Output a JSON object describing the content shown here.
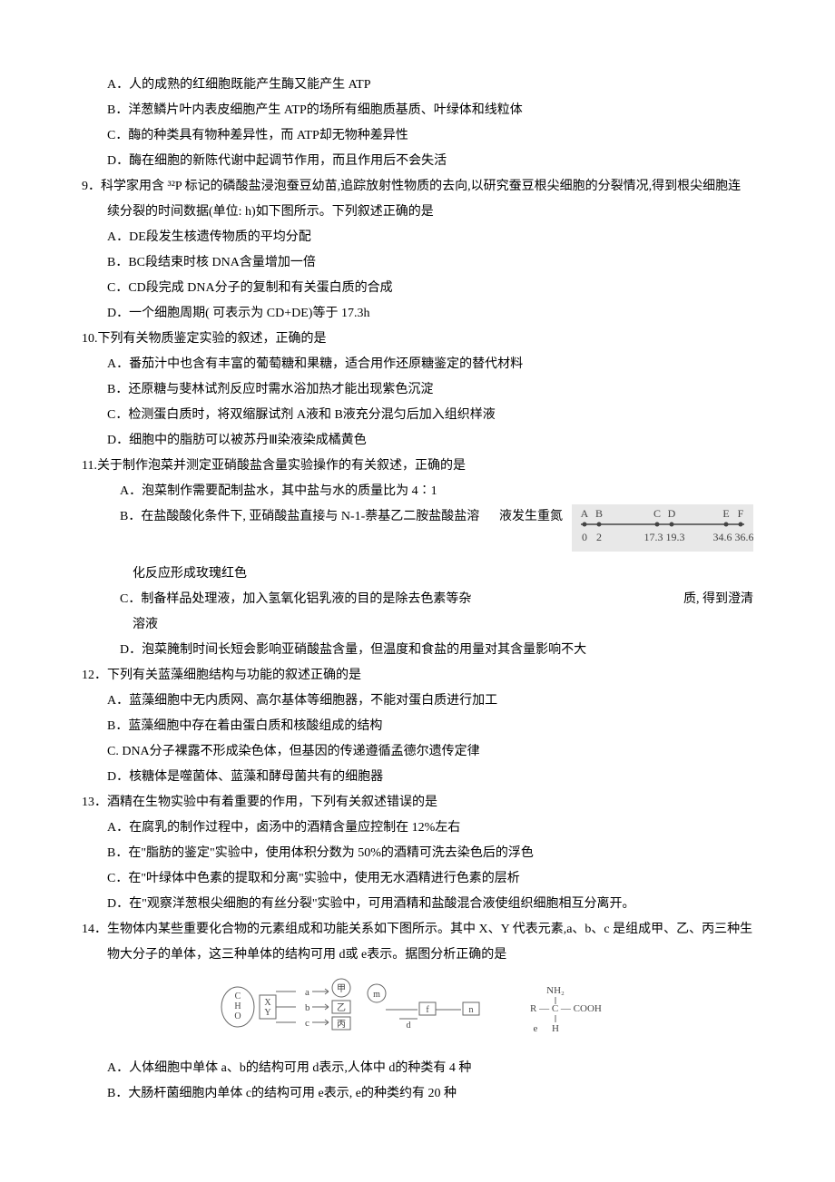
{
  "q8": {
    "A": "A．人的成熟的红细胞既能产生酶又能产生 ATP",
    "B": "B．洋葱鳞片叶内表皮细胞产生 ATP的场所有细胞质基质、叶绿体和线粒体",
    "C": "C．酶的种类具有物种差异性，而 ATP却无物种差异性",
    "D": "D．酶在细胞的新陈代谢中起调节作用，而且作用后不会失活"
  },
  "q9": {
    "stem1": "9．科学家用含 ³²P 标记的磷酸盐浸泡蚕豆幼苗,追踪放射性物质的去向,以研究蚕豆根尖细胞的分裂情况,得到根尖细胞连",
    "stem2": "续分裂的时间数据(单位: h)如下图所示。下列叙述正确的是",
    "A": "A．DE段发生核遗传物质的平均分配",
    "B": "B．BC段结束时核 DNA含量增加一倍",
    "C": "C．CD段完成 DNA分子的复制和有关蛋白质的合成",
    "D": "D．一个细胞周期( 可表示为 CD+DE)等于 17.3h"
  },
  "q10": {
    "stem": "10.下列有关物质鉴定实验的叙述，正确的是",
    "A": "A．番茄汁中也含有丰富的葡萄糖和果糖，适合用作还原糖鉴定的替代材料",
    "B": "B．还原糖与斐林试剂反应时需水浴加热才能出现紫色沉淀",
    "C": "C．检测蛋白质时，将双缩脲试剂 A液和 B液充分混匀后加入组织样液",
    "D": "D．细胞中的脂肪可以被苏丹Ⅲ染液染成橘黄色"
  },
  "q11": {
    "stem": "11.关于制作泡菜并测定亚硝酸盐含量实验操作的有关叙述，正确的是",
    "A": "A．泡菜制作需要配制盐水，其中盐与水的质量比为 4∶1",
    "B1": "B．在盐酸酸化条件下, 亚硝酸盐直接与 N-1-萘基乙二胺盐酸盐溶",
    "B2": "液发生重氮",
    "B3": "化反应形成玫瑰红色",
    "C1": "C．制备样品处理液，加入氢氧化铝乳液的目的是除去色素等杂",
    "C2": "质, 得到澄清",
    "C3": "溶液",
    "D": "D．泡菜腌制时间长短会影响亚硝酸盐含量，但温度和食盐的用量对其含量影响不大"
  },
  "q12": {
    "stem": "12．下列有关蓝藻细胞结构与功能的叙述正确的是",
    "A": "A．蓝藻细胞中无内质网、高尔基体等细胞器，不能对蛋白质进行加工",
    "B": "B．蓝藻细胞中存在着由蛋白质和核酸组成的结构",
    "C": "C. DNA分子裸露不形成染色体，但基因的传递遵循孟德尔遗传定律",
    "D": "D．核糖体是噬菌体、蓝藻和酵母菌共有的细胞器"
  },
  "q13": {
    "stem": "13．酒精在生物实验中有着重要的作用，下列有关叙述错误的是",
    "A": "A．在腐乳的制作过程中，卤汤中的酒精含量应控制在 12%左右",
    "B": "B．在\"脂肪的鉴定\"实验中，使用体积分数为 50%的酒精可洗去染色后的浮色",
    "C": "C．在\"叶绿体中色素的提取和分离\"实验中，使用无水酒精进行色素的层析",
    "D": "D．在\"观察洋葱根尖细胞的有丝分裂\"实验中，可用酒精和盐酸混合液使组织细胞相互分离开。"
  },
  "q14": {
    "stem1": "14．生物体内某些重要化合物的元素组成和功能关系如下图所示。其中 X、Y 代表元素,a、b、c 是组成甲、乙、丙三种生",
    "stem2": "物大分子的单体，这三种单体的结构可用 d或 e表示。据图分析正确的是",
    "A": "A．人体细胞中单体 a、b的结构可用 d表示,人体中 d的种类有 4 种",
    "B": "B．大肠杆菌细胞内单体 c的结构可用 e表示, e的种类约有 20 种"
  },
  "timeline": {
    "labels": [
      "A",
      "B",
      "C",
      "D",
      "E",
      "F"
    ],
    "values": [
      "0",
      "2",
      "17.3",
      "19.3",
      "34.6",
      "36.6"
    ]
  }
}
